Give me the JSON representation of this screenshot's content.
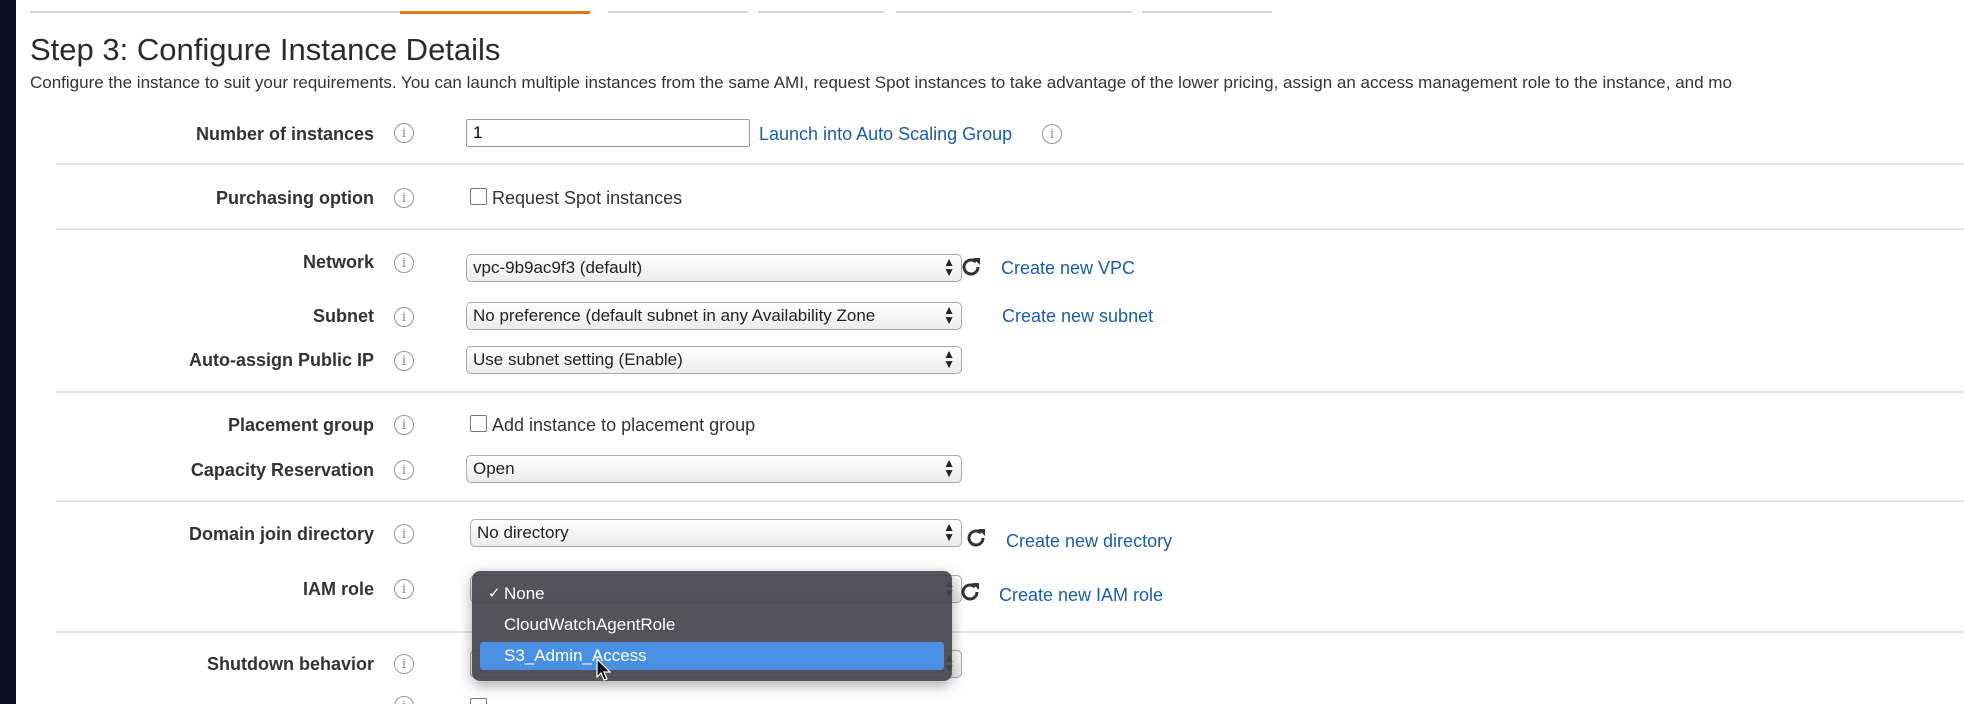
{
  "page": {
    "title": "Step 3: Configure Instance Details",
    "description": "Configure the instance to suit your requirements. You can launch multiple instances from the same AMI, request Spot instances to take advantage of the lower pricing, assign an access management role to the instance, and mo"
  },
  "tabs": [
    {
      "active": false
    },
    {
      "active": false
    },
    {
      "active": true
    },
    {
      "active": false
    },
    {
      "active": false
    },
    {
      "active": false
    },
    {
      "active": false
    }
  ],
  "fields": {
    "instances": {
      "label": "Number of instances",
      "value": "1",
      "link": "Launch into Auto Scaling Group"
    },
    "purchasing": {
      "label": "Purchasing option",
      "checkbox_label": "Request Spot instances"
    },
    "network": {
      "label": "Network",
      "value": "vpc-9b9ac9f3 (default)",
      "link": "Create new VPC"
    },
    "subnet": {
      "label": "Subnet",
      "value": "No preference (default subnet in any Availability Zone",
      "link": "Create new subnet"
    },
    "public_ip": {
      "label": "Auto-assign Public IP",
      "value": "Use subnet setting (Enable)"
    },
    "placement": {
      "label": "Placement group",
      "checkbox_label": "Add instance to placement group"
    },
    "capacity": {
      "label": "Capacity Reservation",
      "value": "Open"
    },
    "domain": {
      "label": "Domain join directory",
      "value": "No directory",
      "link": "Create new directory"
    },
    "iam": {
      "label": "IAM role",
      "link": "Create new IAM role"
    },
    "shutdown": {
      "label": "Shutdown behavior"
    }
  },
  "iam_dropdown": {
    "options": [
      {
        "label": "None",
        "checked": true,
        "highlighted": false
      },
      {
        "label": "CloudWatchAgentRole",
        "checked": false,
        "highlighted": false
      },
      {
        "label": "S3_Admin_Access",
        "checked": false,
        "highlighted": true
      }
    ]
  },
  "colors": {
    "accent": "#ec7211",
    "link": "#1a5ea8",
    "highlight": "#4a90e2"
  },
  "icons": [
    "info-icon",
    "refresh-icon",
    "checkmark-icon",
    "updown-arrows-icon",
    "mouse-cursor-icon"
  ]
}
